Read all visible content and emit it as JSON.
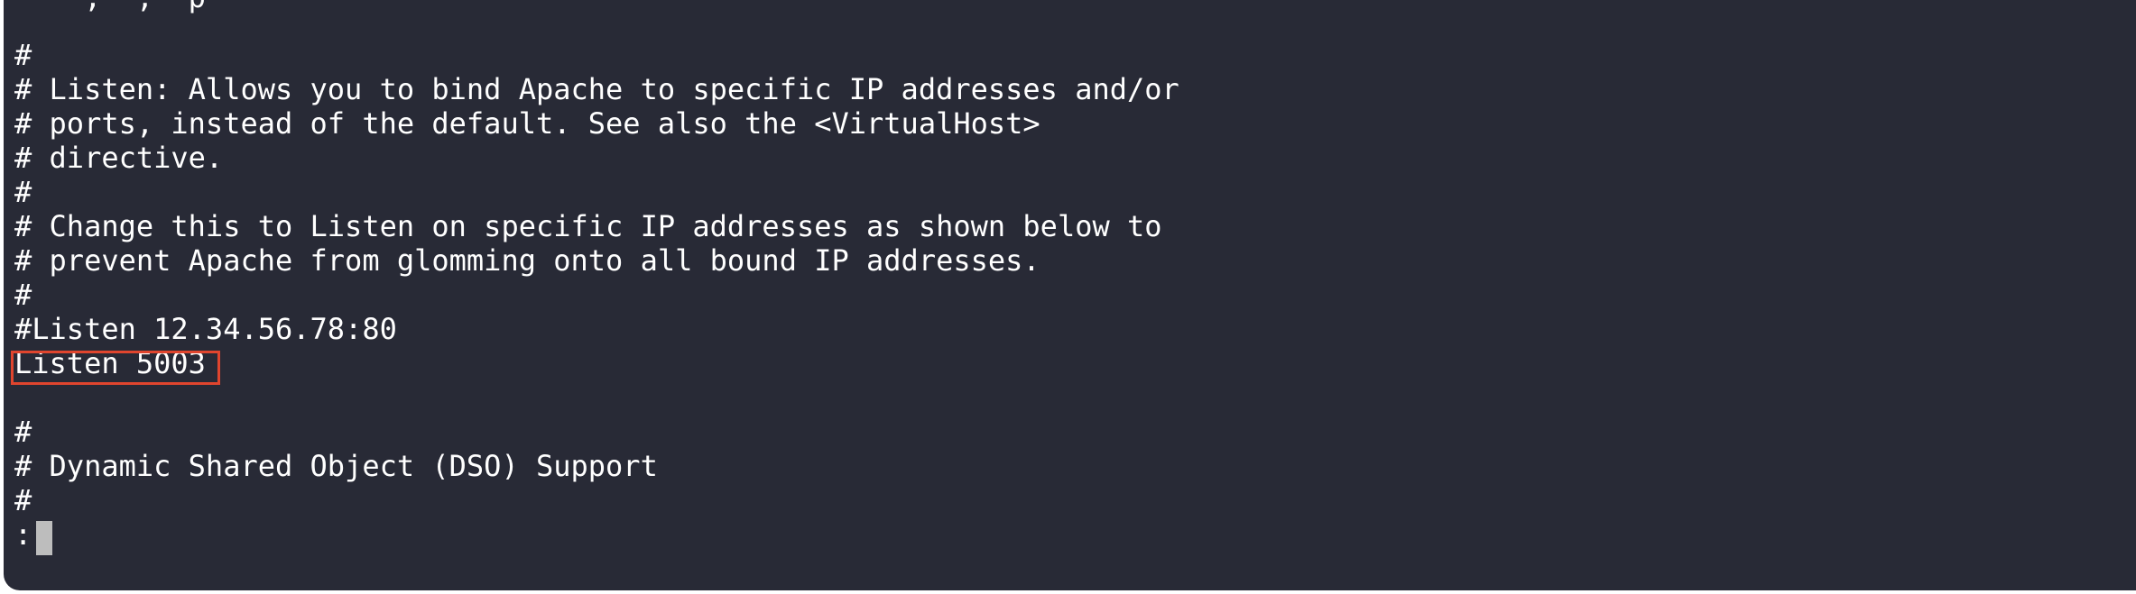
{
  "terminal": {
    "lines": [
      "    ,  ,  p",
      "#",
      "# Listen: Allows you to bind Apache to specific IP addresses and/or",
      "# ports, instead of the default. See also the <VirtualHost>",
      "# directive.",
      "#",
      "# Change this to Listen on specific IP addresses as shown below to",
      "# prevent Apache from glomming onto all bound IP addresses.",
      "#",
      "#Listen 12.34.56.78:80",
      "Listen 5003",
      "",
      "#",
      "# Dynamic Shared Object (DSO) Support",
      "#",
      ":"
    ],
    "highlighted_line": "Listen 5003",
    "highlight_color": "#e0452e",
    "background_color": "#282a36",
    "text_color": "#ffffff"
  }
}
